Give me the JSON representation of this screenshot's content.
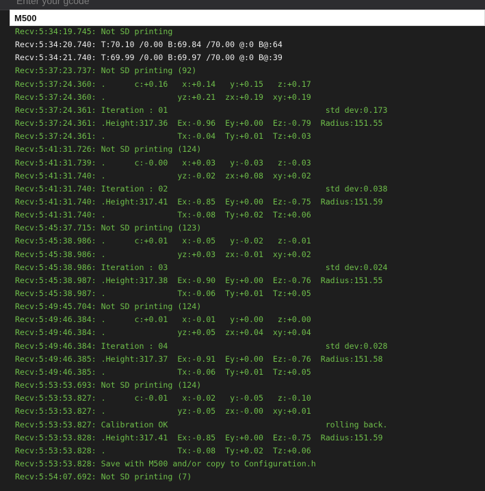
{
  "command_field": {
    "placeholder": "Enter your gcode",
    "value": "M500"
  },
  "colors": {
    "log_default": "#6fbf4a",
    "log_temperature": "#ececec",
    "background": "#1e1e1e"
  },
  "log_lines": [
    {
      "text": "Recv:5:34:19.745: Not SD printing",
      "kind": "default"
    },
    {
      "text": "Recv:5:34:20.740: T:70.10 /0.00 B:69.84 /70.00 @:0 B@:64",
      "kind": "temperature"
    },
    {
      "text": "Recv:5:34:21.740: T:69.99 /0.00 B:69.97 /70.00 @:0 B@:39",
      "kind": "temperature"
    },
    {
      "text": "Recv:5:37:23.737: Not SD printing (92)",
      "kind": "default"
    },
    {
      "text": "Recv:5:37:24.360: .      c:+0.16   x:+0.14   y:+0.15   z:+0.17",
      "kind": "default"
    },
    {
      "text": "Recv:5:37:24.360: .               yz:+0.21  zx:+0.19  xy:+0.19",
      "kind": "default"
    },
    {
      "text": "Recv:5:37:24.361: Iteration : 01                                 std dev:0.173",
      "kind": "default"
    },
    {
      "text": "Recv:5:37:24.361: .Height:317.36  Ex:-0.96  Ey:+0.00  Ez:-0.79  Radius:151.55",
      "kind": "default"
    },
    {
      "text": "Recv:5:37:24.361: .               Tx:-0.04  Ty:+0.01  Tz:+0.03",
      "kind": "default"
    },
    {
      "text": "Recv:5:41:31.726: Not SD printing (124)",
      "kind": "default"
    },
    {
      "text": "Recv:5:41:31.739: .      c:-0.00   x:+0.03   y:-0.03   z:-0.03",
      "kind": "default"
    },
    {
      "text": "Recv:5:41:31.740: .               yz:-0.02  zx:+0.08  xy:+0.02",
      "kind": "default"
    },
    {
      "text": "Recv:5:41:31.740: Iteration : 02                                 std dev:0.038",
      "kind": "default"
    },
    {
      "text": "Recv:5:41:31.740: .Height:317.41  Ex:-0.85  Ey:+0.00  Ez:-0.75  Radius:151.59",
      "kind": "default"
    },
    {
      "text": "Recv:5:41:31.740: .               Tx:-0.08  Ty:+0.02  Tz:+0.06",
      "kind": "default"
    },
    {
      "text": "Recv:5:45:37.715: Not SD printing (123)",
      "kind": "default"
    },
    {
      "text": "Recv:5:45:38.986: .      c:+0.01   x:-0.05   y:-0.02   z:-0.01",
      "kind": "default"
    },
    {
      "text": "Recv:5:45:38.986: .               yz:+0.03  zx:-0.01  xy:+0.02",
      "kind": "default"
    },
    {
      "text": "Recv:5:45:38.986: Iteration : 03                                 std dev:0.024",
      "kind": "default"
    },
    {
      "text": "Recv:5:45:38.987: .Height:317.38  Ex:-0.90  Ey:+0.00  Ez:-0.76  Radius:151.55",
      "kind": "default"
    },
    {
      "text": "Recv:5:45:38.987: .               Tx:-0.06  Ty:+0.01  Tz:+0.05",
      "kind": "default"
    },
    {
      "text": "Recv:5:49:45.704: Not SD printing (124)",
      "kind": "default"
    },
    {
      "text": "Recv:5:49:46.384: .      c:+0.01   x:-0.01   y:+0.00   z:+0.00",
      "kind": "default"
    },
    {
      "text": "Recv:5:49:46.384: .               yz:+0.05  zx:+0.04  xy:+0.04",
      "kind": "default"
    },
    {
      "text": "Recv:5:49:46.384: Iteration : 04                                 std dev:0.028",
      "kind": "default"
    },
    {
      "text": "Recv:5:49:46.385: .Height:317.37  Ex:-0.91  Ey:+0.00  Ez:-0.76  Radius:151.58",
      "kind": "default"
    },
    {
      "text": "Recv:5:49:46.385: .               Tx:-0.06  Ty:+0.01  Tz:+0.05",
      "kind": "default"
    },
    {
      "text": "Recv:5:53:53.693: Not SD printing (124)",
      "kind": "default"
    },
    {
      "text": "Recv:5:53:53.827: .      c:-0.01   x:-0.02   y:-0.05   z:-0.10",
      "kind": "default"
    },
    {
      "text": "Recv:5:53:53.827: .               yz:-0.05  zx:-0.00  xy:+0.01",
      "kind": "default"
    },
    {
      "text": "Recv:5:53:53.827: Calibration OK                                 rolling back.",
      "kind": "default"
    },
    {
      "text": "Recv:5:53:53.828: .Height:317.41  Ex:-0.85  Ey:+0.00  Ez:-0.75  Radius:151.59",
      "kind": "default"
    },
    {
      "text": "Recv:5:53:53.828: .               Tx:-0.08  Ty:+0.02  Tz:+0.06",
      "kind": "default"
    },
    {
      "text": "Recv:5:53:53.828: Save with M500 and/or copy to Configuration.h",
      "kind": "default"
    },
    {
      "text": "Recv:5:54:07.692: Not SD printing (7)",
      "kind": "default"
    }
  ]
}
